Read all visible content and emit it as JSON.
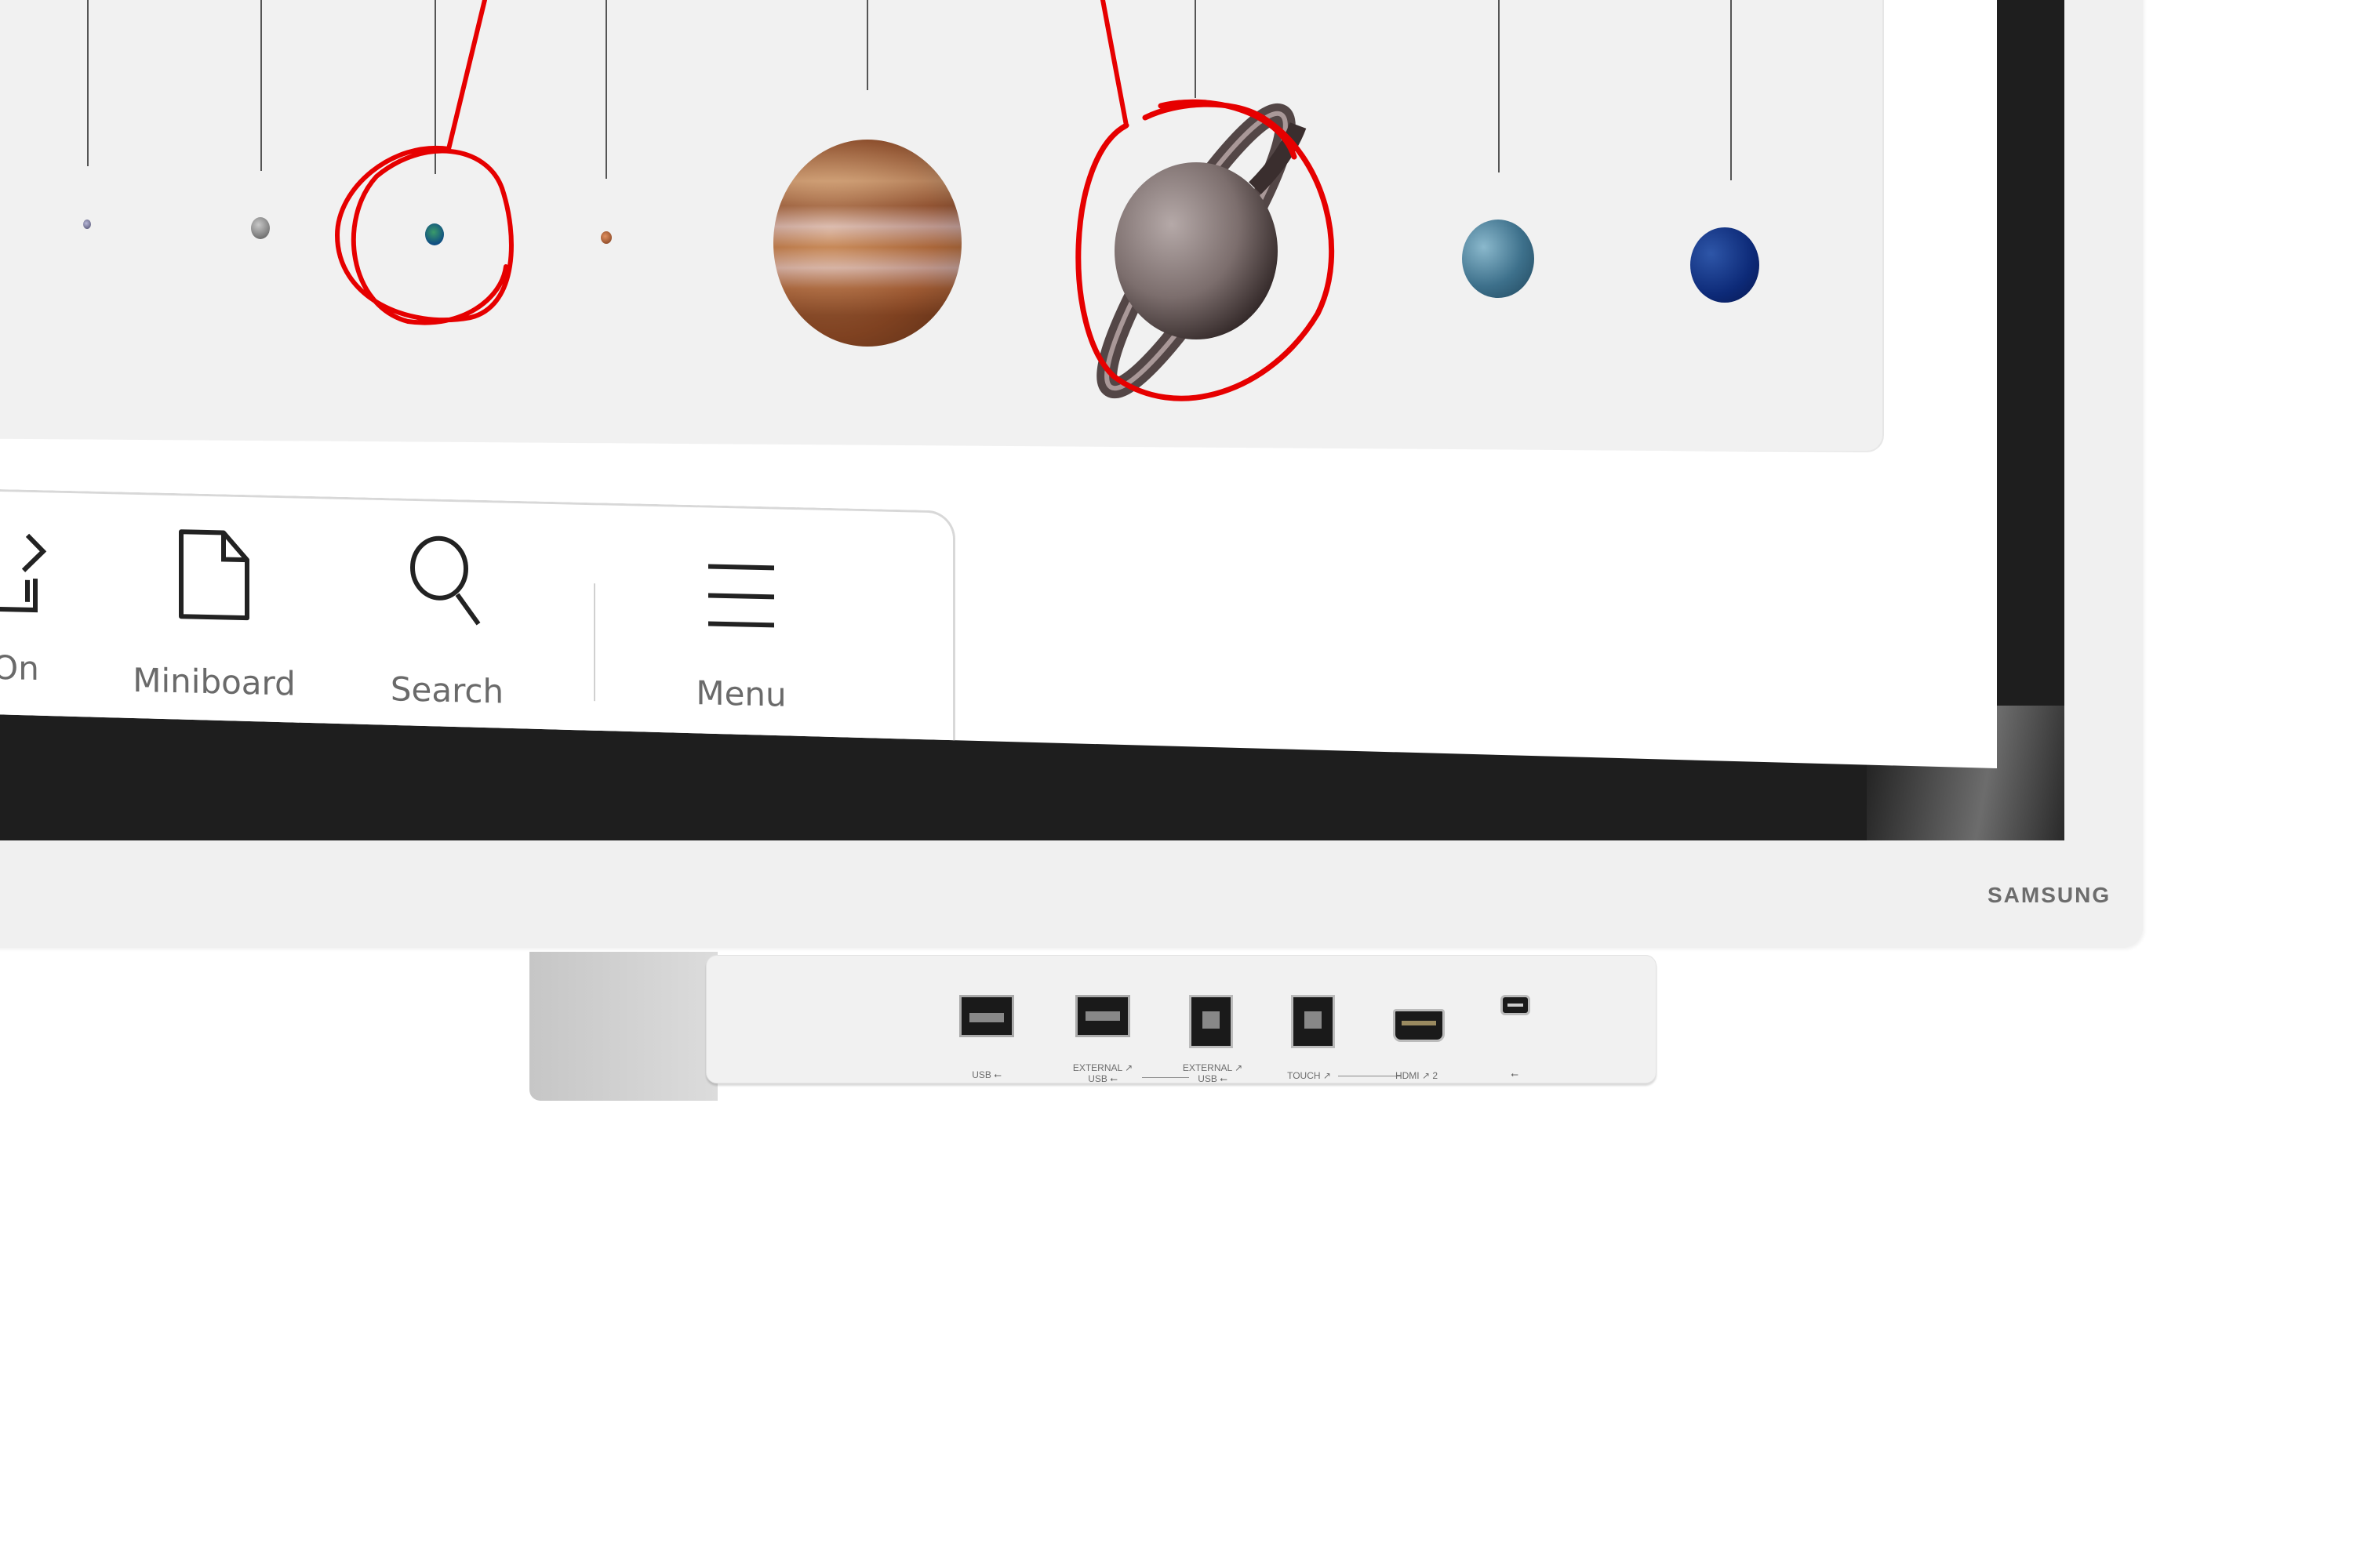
{
  "device": {
    "brand": "SAMSUNG",
    "colors": {
      "frame": "#f0f0f0",
      "bezel": "#1e1e1e",
      "canvas": "#f1f1f1",
      "annotation": "#e60000"
    }
  },
  "canvas": {
    "content": "Solar system illustration",
    "planets": [
      {
        "name": "Mercury",
        "color": "#6b6b8a",
        "circled": false
      },
      {
        "name": "Venus",
        "color": "#8a8a8a",
        "circled": false
      },
      {
        "name": "Earth",
        "color": "#1f6f8f",
        "circled": true
      },
      {
        "name": "Mars",
        "color": "#b0603a",
        "circled": false
      },
      {
        "name": "Jupiter",
        "color": "#b07a50",
        "circled": false
      },
      {
        "name": "Saturn",
        "color": "#8a7c7a",
        "circled": true
      },
      {
        "name": "Uranus",
        "color": "#3f7590",
        "circled": false
      },
      {
        "name": "Neptune",
        "color": "#14337f",
        "circled": false
      }
    ]
  },
  "toolbar": {
    "items": [
      {
        "label": "On",
        "icon": "screen-share-icon"
      },
      {
        "label": "Miniboard",
        "icon": "page-icon"
      },
      {
        "label": "Search",
        "icon": "search-icon"
      },
      {
        "label": "Menu",
        "icon": "menu-icon"
      }
    ]
  },
  "ports": [
    {
      "label": "USB ⭠",
      "type": "usb-a"
    },
    {
      "label": "EXTERNAL ↗\nUSB ⭠",
      "type": "usb-a"
    },
    {
      "label": "EXTERNAL ↗\nUSB ⭠",
      "type": "usb-b"
    },
    {
      "label": "TOUCH ↗",
      "type": "usb-b"
    },
    {
      "label": "HDMI ↗ 2",
      "type": "hdmi"
    },
    {
      "label": "⭠",
      "type": "usb-c"
    }
  ]
}
